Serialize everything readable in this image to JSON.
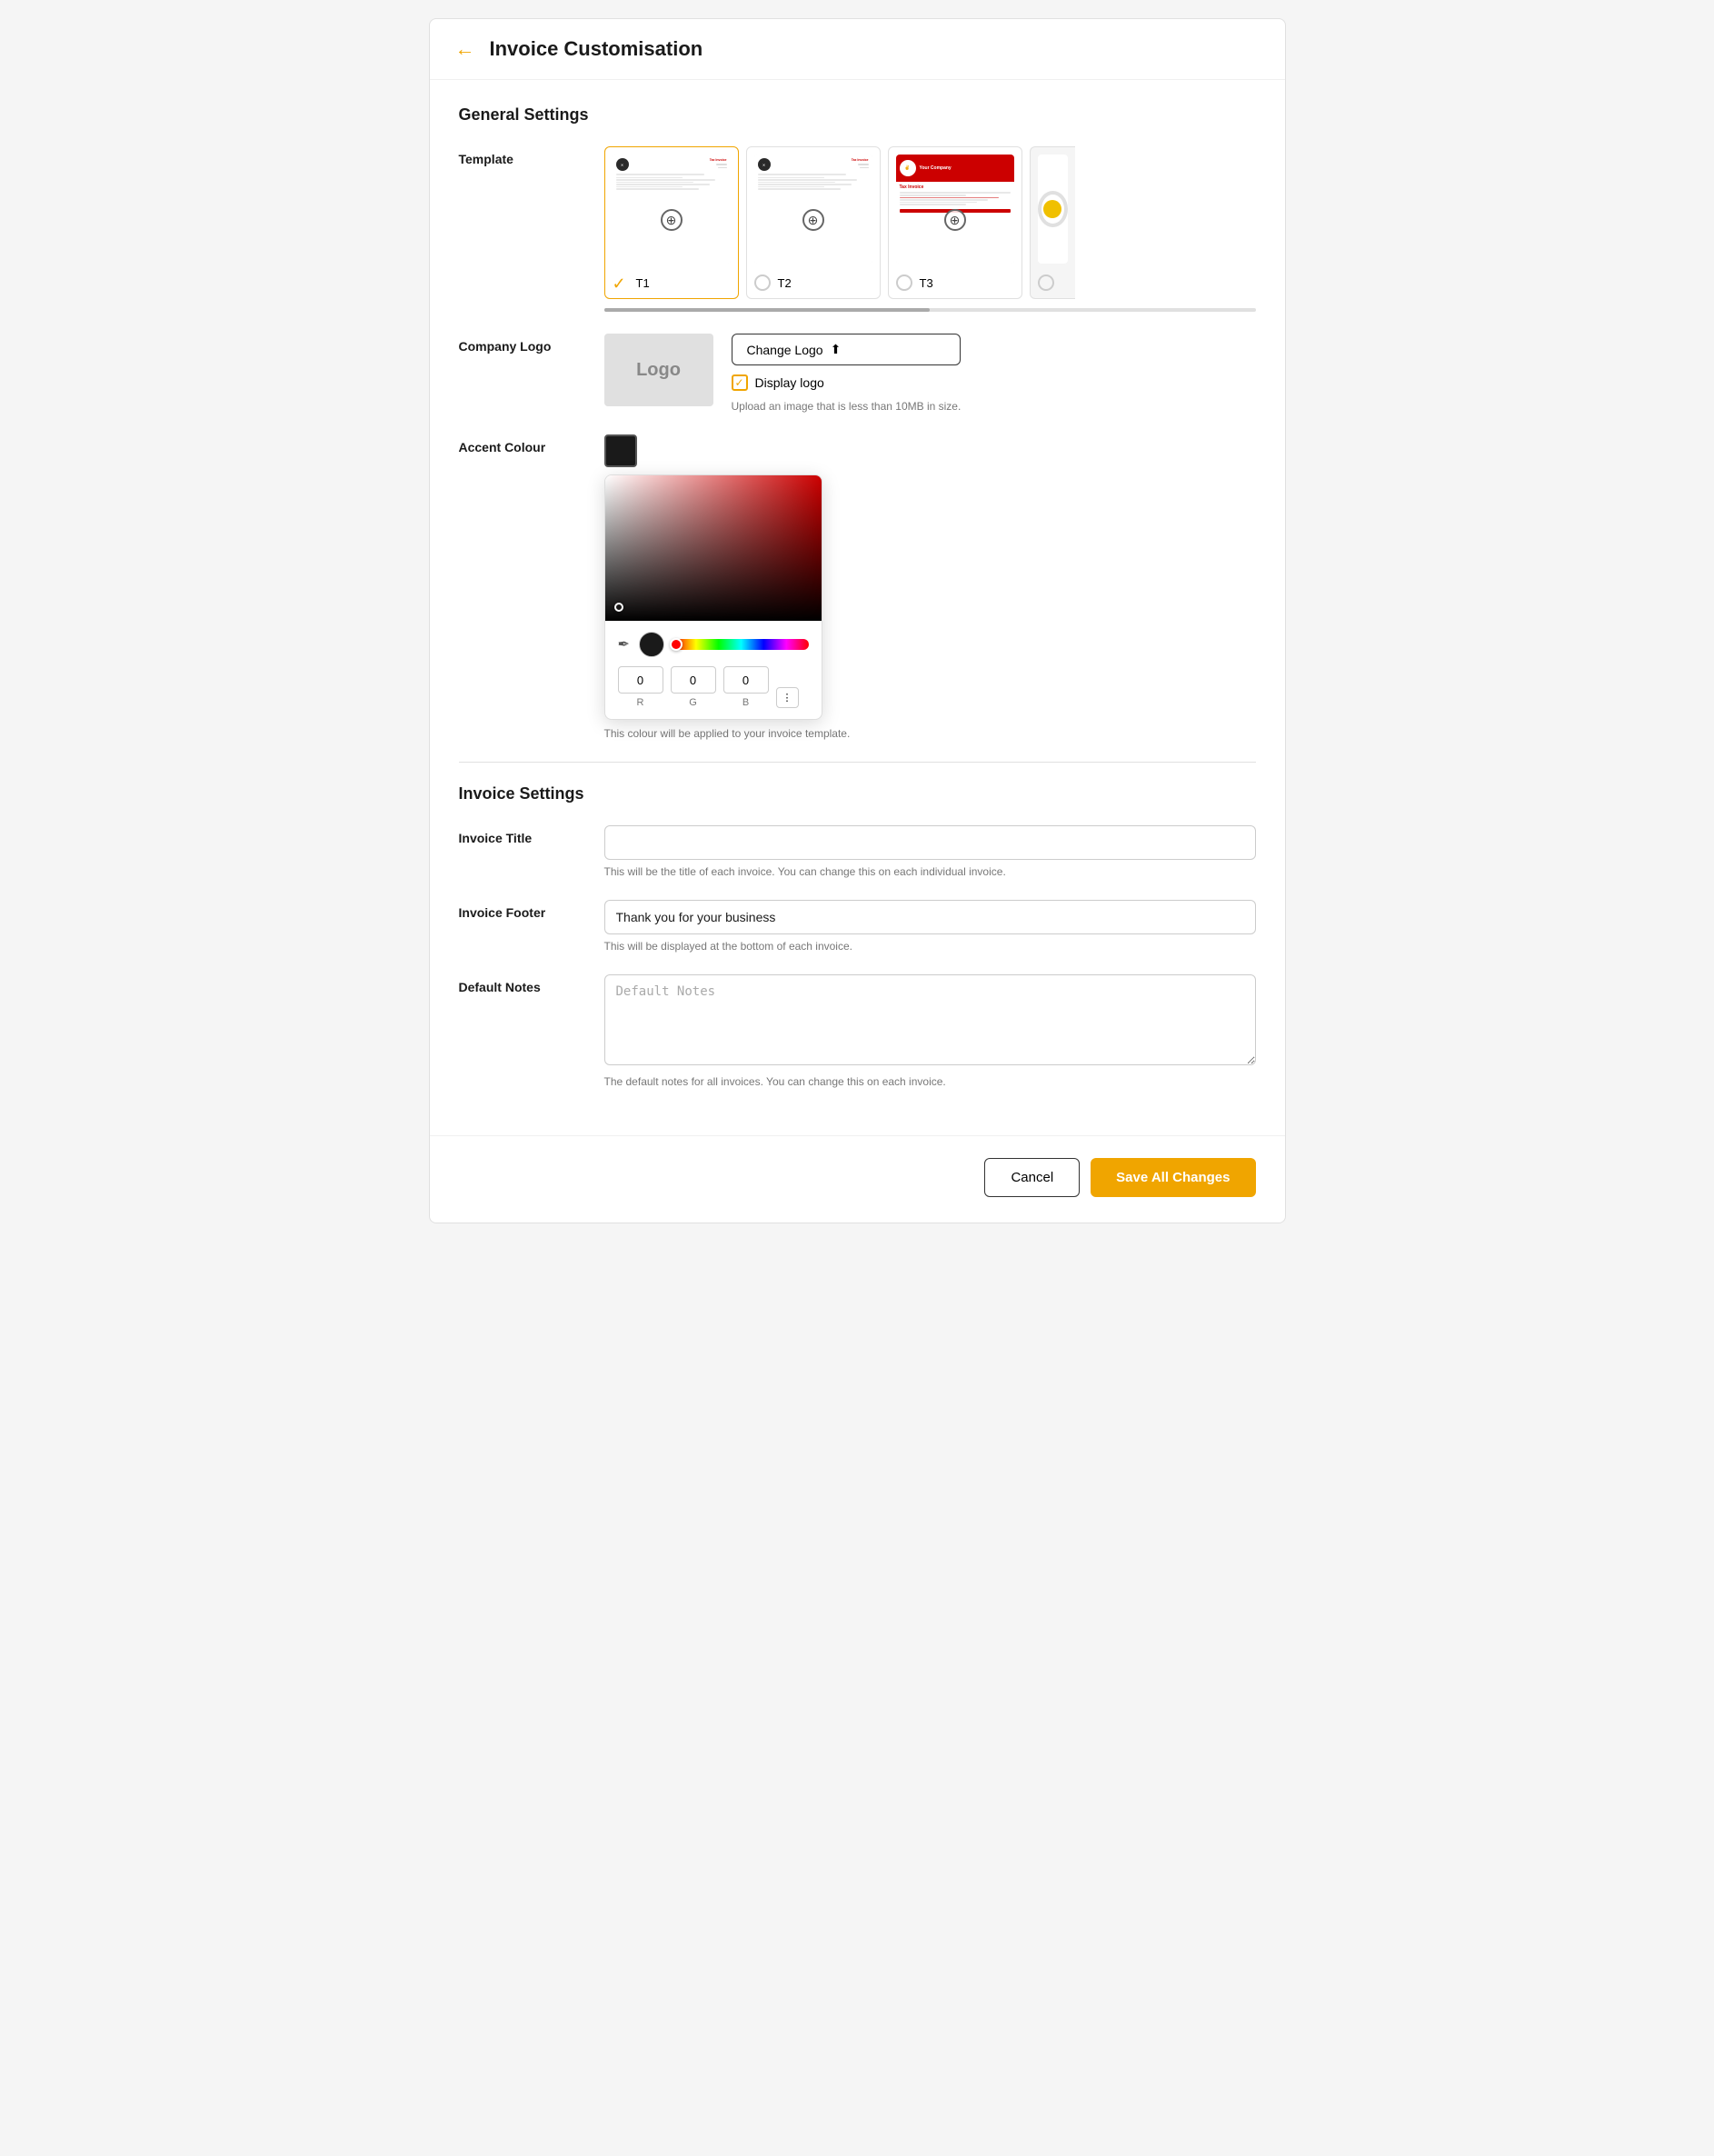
{
  "header": {
    "back_label": "←",
    "title": "Invoice Customisation"
  },
  "general_settings": {
    "title": "General Settings",
    "template_label": "Template",
    "templates": [
      {
        "id": "T1",
        "label": "T1",
        "selected": true
      },
      {
        "id": "T2",
        "label": "T2",
        "selected": false
      },
      {
        "id": "T3",
        "label": "T3",
        "selected": false
      },
      {
        "id": "T4",
        "label": "",
        "selected": false,
        "partial": true
      }
    ],
    "company_logo_label": "Company Logo",
    "logo_placeholder": "Logo",
    "change_logo_btn": "Change Logo",
    "display_logo_label": "Display logo",
    "upload_hint": "Upload an image that is less than 10MB in size.",
    "accent_colour_label": "Accent Colour",
    "accent_hint": "This colour will be applied to your invoice template.",
    "accent_color": "#1a1a1a"
  },
  "color_picker": {
    "r_value": "0",
    "g_value": "0",
    "b_value": "0",
    "r_label": "R",
    "g_label": "G",
    "b_label": "B"
  },
  "invoice_settings": {
    "title": "Invoice Settings",
    "invoice_title_label": "Invoice Title",
    "invoice_title_placeholder": "",
    "invoice_title_hint": "This will be the title of each invoice. You can change this on each individual invoice.",
    "invoice_footer_label": "Invoice Footer",
    "invoice_footer_value": "Thank you for your business",
    "invoice_footer_hint": "This will be displayed at the bottom of each invoice.",
    "default_notes_label": "Default Notes",
    "default_notes_placeholder": "Default Notes",
    "default_notes_hint": "The default notes for all invoices. You can change this on each invoice."
  },
  "footer": {
    "cancel_label": "Cancel",
    "save_label": "Save All Changes"
  }
}
